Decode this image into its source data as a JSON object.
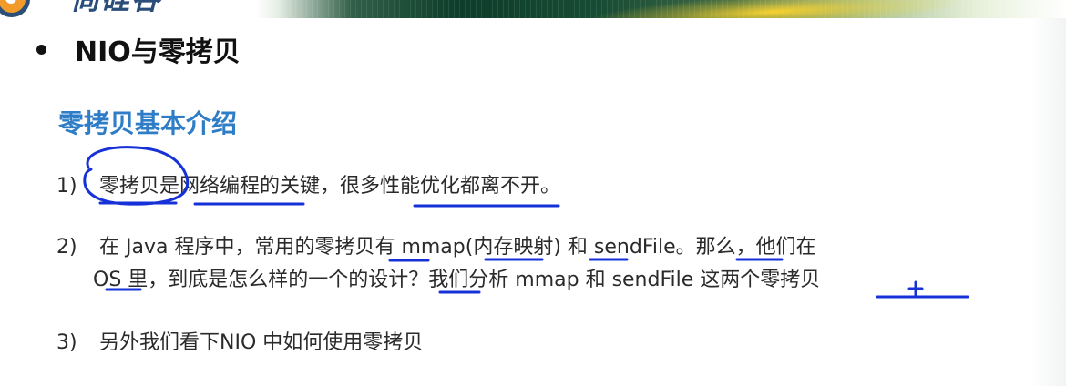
{
  "slide": {
    "heading": "NIO与零拷贝",
    "subheading": "零拷贝基本介绍",
    "points": [
      {
        "number": "1)",
        "text": "零拷贝是网络编程的关键，很多性能优化都离不开。"
      },
      {
        "number": "2)",
        "line1": "在 Java 程序中，常用的零拷贝有 mmap(内存映射) 和 sendFile。那么，他们在",
        "line2": "OS 里，到底是怎么样的一个的设计？我们分析 mmap 和 sendFile 这两个零拷贝"
      },
      {
        "number": "3)",
        "text": "另外我们看下NIO 中如何使用零拷贝"
      }
    ]
  },
  "colors": {
    "subheading": "#2f7dc6",
    "annotation": "#1631d8",
    "banner_dark": "#0e3d2b",
    "banner_accent": "#ffd62e"
  }
}
